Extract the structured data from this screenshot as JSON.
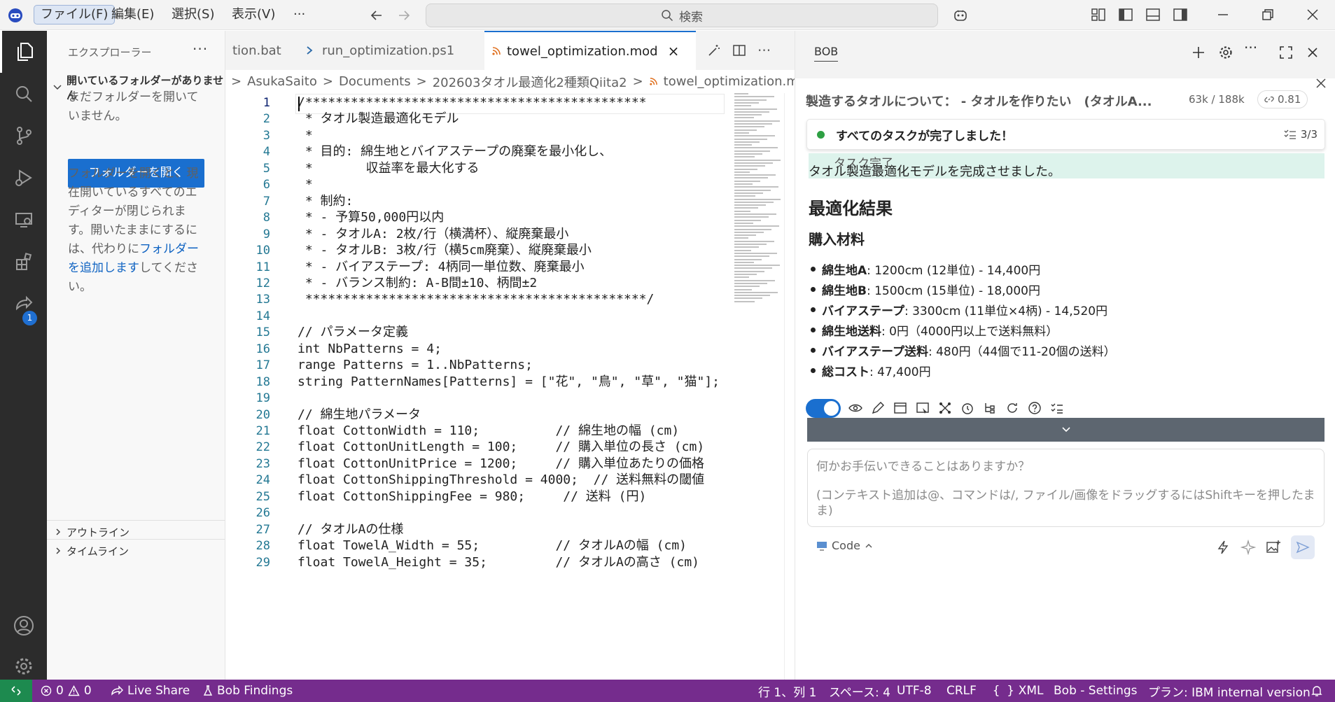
{
  "titlebar": {
    "menus": [
      "ファイル(F)",
      "編集(E)",
      "選択(S)",
      "表示(V)"
    ],
    "more": "···",
    "search_placeholder": "検索"
  },
  "activity_bar": {
    "extensions_badge": "1"
  },
  "explorer": {
    "title": "エクスプローラー",
    "dots": "···",
    "section": "開いているフォルダーがありません",
    "text1": "まだフォルダーを開いていません。",
    "open_button": "フォルダーを開く",
    "text2": "フォルダーを開くと、現在開いているすべてのエディターが閉じられます。開いたままにするには、代わりに",
    "add_folder_link": "フォルダーを追加します",
    "text3": "してください。",
    "outline": "アウトライン",
    "timeline": "タイムライン"
  },
  "tabs": [
    {
      "label": "tion.bat"
    },
    {
      "label": "run_optimization.ps1"
    },
    {
      "label": "towel_optimization.mod",
      "close": "×"
    }
  ],
  "editor_actions_more": "···",
  "breadcrumb": [
    "AsukaSaito",
    "Documents",
    "202603タオル最適化2種類Qiita2",
    "towel_optimization.mod"
  ],
  "editor": {
    "line_numbers": [
      "1",
      "2",
      "3",
      "4",
      "5",
      "6",
      "7",
      "8",
      "9",
      "10",
      "11",
      "12",
      "13",
      "14",
      "15",
      "16",
      "17",
      "18",
      "19",
      "20",
      "21",
      "22",
      "23",
      "24",
      "25",
      "26",
      "27",
      "28",
      "29"
    ],
    "lines": [
      "/*********************************************",
      " * タオル製造最適化モデル",
      " *",
      " * 目的: 綿生地とバイアステープの廃棄を最小化し、",
      " *       収益率を最大化する",
      " *",
      " * 制約:",
      " * - 予算50,000円以内",
      " * - タオルA: 2枚/行（横満杯）、縦廃棄最小",
      " * - タオルB: 3枚/行（横5cm廃棄）、縦廃棄最小",
      " * - バイアステープ: 4柄同一単位数、廃棄最小",
      " * - バランス制約: A-B間±10、柄間±2",
      " *********************************************/",
      "",
      "// パラメータ定義",
      "int NbPatterns = 4;",
      "range Patterns = 1..NbPatterns;",
      "string PatternNames[Patterns] = [\"花\", \"鳥\", \"草\", \"猫\"];",
      "",
      "// 綿生地パラメータ",
      "float CottonWidth = 110;          // 綿生地の幅 (cm)",
      "float CottonUnitLength = 100;     // 購入単位の長さ (cm)",
      "float CottonUnitPrice = 1200;     // 購入単位あたりの価格",
      "float CottonShippingThreshold = 4000;  // 送料無料の閾値",
      "float CottonShippingFee = 980;     // 送料 (円)",
      "",
      "// タオルAの仕様",
      "float TowelA_Width = 55;          // タオルAの幅 (cm)",
      "float TowelA_Height = 35;         // タオルAの高さ (cm)"
    ]
  },
  "panel": {
    "tab": "BOB",
    "more": "···",
    "chat_title": "製造するタオルについて： - タオルを作りたい　(タオルA...",
    "tokens": "63k / 188k",
    "cost": "0.81",
    "task_status": "すべてのタスクが完了しました！",
    "task_count": "3/3",
    "done_label": "タスク完了",
    "intro": "タオル製造最適化モデルを完成させました。",
    "heading": "最適化結果",
    "subheading": "購入材料",
    "items": [
      {
        "name": "綿生地A",
        "value": ": 1200cm (12単位) - 14,400円"
      },
      {
        "name": "綿生地B",
        "value": ": 1500cm (15単位) - 18,000円"
      },
      {
        "name": "バイアステープ",
        "value": ": 3300cm (11単位×4柄) - 14,520円"
      },
      {
        "name": "綿生地送料",
        "value": ": 0円（4000円以上で送料無料）"
      },
      {
        "name": "バイアステープ送料",
        "value": ": 480円（44個で11-20個の送料）"
      },
      {
        "name": "総コスト",
        "value": ": 47,400円"
      }
    ],
    "input_placeholder": "何かお手伝いできることはありますか？",
    "input_hint": "(コンテキスト追加は@、コマンドは/, ファイル/画像をドラッグするにはShiftキーを押したまま)",
    "mode": "Code"
  },
  "statusbar": {
    "problems": "0",
    "warnings": "0",
    "live_share": "Live Share",
    "bob_findings": "Bob Findings",
    "position": "行 1、列 1",
    "spaces": "スペース: 4",
    "encoding": "UTF-8",
    "eol": "CRLF",
    "language": "XML",
    "settings": "Bob - Settings",
    "plan": "プラン: IBM internal version"
  },
  "colors": {
    "accent": "#1a6fcf",
    "statusbar": "#752c8d",
    "activitybar": "#2c2c2c",
    "success": "#2ea043"
  }
}
